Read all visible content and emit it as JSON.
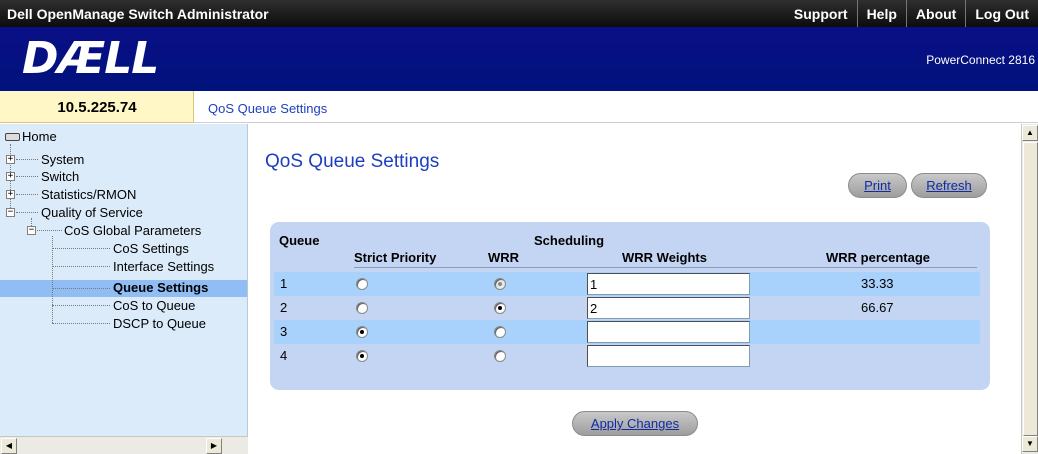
{
  "topbar": {
    "title": "Dell OpenManage Switch Administrator",
    "links": [
      "Support",
      "Help",
      "About",
      "Log Out"
    ]
  },
  "banner": {
    "logo_text": "DÆLL",
    "product": "PowerConnect 2816"
  },
  "device_ip": "10.5.225.74",
  "breadcrumb": "QoS Queue Settings",
  "sidebar": {
    "home": "Home",
    "items": {
      "system": "System",
      "switch": "Switch",
      "statistics": "Statistics/RMON",
      "qos": "Quality of Service",
      "cos_global": "CoS Global Parameters",
      "cos_settings": "CoS Settings",
      "interface_settings": "Interface Settings",
      "queue_settings": "Queue Settings",
      "cos_to_queue": "CoS to Queue",
      "dscp_to_queue": "DSCP to Queue"
    }
  },
  "main": {
    "title": "QoS Queue Settings",
    "print_label": "Print",
    "refresh_label": "Refresh",
    "apply_label": "Apply Changes"
  },
  "table": {
    "headers": {
      "queue": "Queue",
      "scheduling": "Scheduling",
      "strict_priority": "Strict Priority",
      "wrr": "WRR",
      "wrr_weights": "WRR Weights",
      "wrr_percentage": "WRR percentage"
    },
    "rows": [
      {
        "queue": "1",
        "strict_priority": false,
        "wrr": true,
        "wrr_disabled": true,
        "weight": "1",
        "percentage": "33.33"
      },
      {
        "queue": "2",
        "strict_priority": false,
        "wrr": true,
        "wrr_disabled": false,
        "weight": "2",
        "percentage": "66.67"
      },
      {
        "queue": "3",
        "strict_priority": true,
        "wrr": false,
        "wrr_disabled": false,
        "weight": "",
        "percentage": ""
      },
      {
        "queue": "4",
        "strict_priority": true,
        "wrr": false,
        "wrr_disabled": false,
        "weight": "",
        "percentage": ""
      }
    ]
  }
}
